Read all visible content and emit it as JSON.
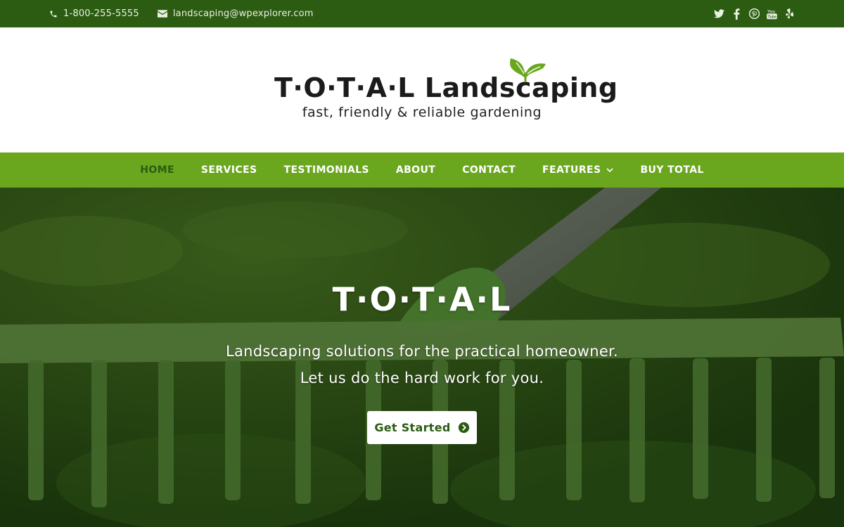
{
  "topbar": {
    "phone": "1-800-255-5555",
    "email": "landscaping@wpexplorer.com",
    "social": [
      "twitter-icon",
      "facebook-icon",
      "pinterest-icon",
      "youtube-icon",
      "yelp-icon"
    ]
  },
  "header": {
    "logo_name": "T·O·T·A·L Landscaping",
    "tagline": "fast, friendly & reliable gardening"
  },
  "nav": {
    "items": [
      {
        "label": "HOME",
        "active": true
      },
      {
        "label": "SERVICES"
      },
      {
        "label": "TESTIMONIALS"
      },
      {
        "label": "ABOUT"
      },
      {
        "label": "CONTACT"
      },
      {
        "label": "FEATURES",
        "has_dropdown": true
      },
      {
        "label": "BUY TOTAL"
      }
    ]
  },
  "hero": {
    "title": "T·O·T·A·L",
    "line1": "Landscaping solutions for the practical homeowner.",
    "line2": "Let us do the hard work for you.",
    "cta_label": "Get Started"
  },
  "colors": {
    "topbar": "#2c5c12",
    "nav": "#6aa71e",
    "accent": "#6aa71e",
    "dark_green": "#2c5c12"
  }
}
